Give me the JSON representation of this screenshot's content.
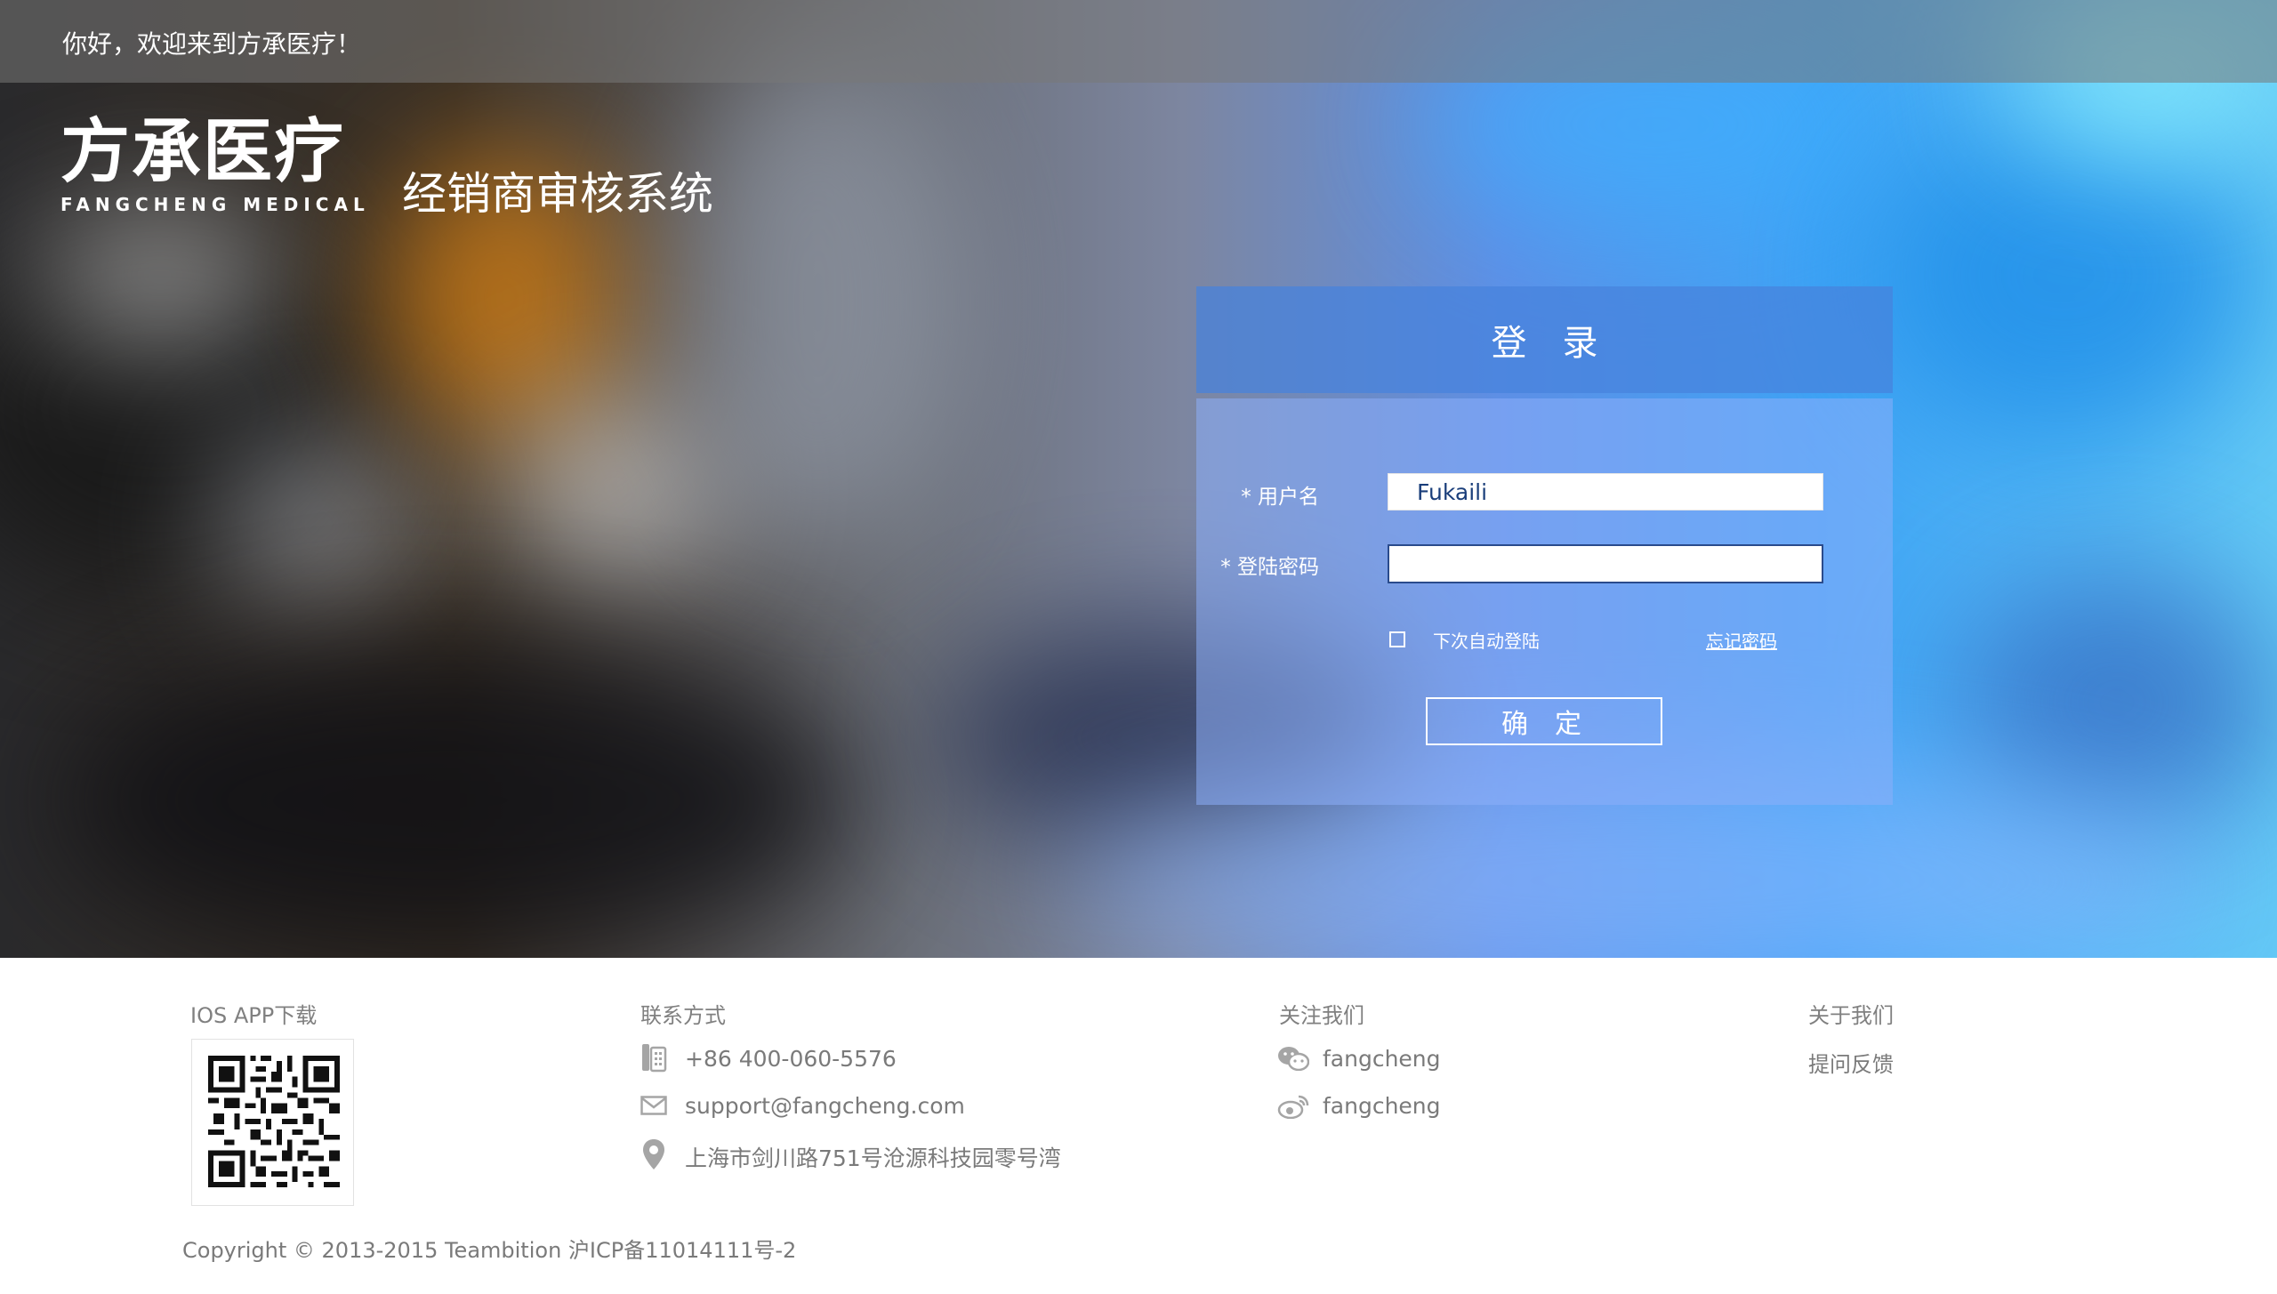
{
  "header": {
    "greeting": "你好，欢迎来到方承医疗！",
    "logo_cn": "方承医疗",
    "logo_en": "FANGCHENG MEDICAL",
    "system_title": "经销商审核系统"
  },
  "login": {
    "title": "登录",
    "username_label": "* 用户名",
    "username_value": "Fukaili",
    "password_label": "* 登陆密码",
    "password_value": "",
    "remember_label": "下次自动登陆",
    "remember_checked": false,
    "forgot_label": "忘记密码",
    "submit_label": "确定"
  },
  "footer": {
    "app": {
      "heading": "IOS APP下载"
    },
    "contact": {
      "heading": "联系方式",
      "phone": "+86 400-060-5576",
      "email": "support@fangcheng.com",
      "address": "上海市剑川路751号沧源科技园零号湾"
    },
    "follow": {
      "heading": "关注我们",
      "wechat": "fangcheng",
      "weibo": "fangcheng"
    },
    "about": {
      "heading": "关于我们",
      "feedback": "提问反馈"
    },
    "copyright": "Copyright © 2013-2015 Teambition 沪ICP备11014111号-2"
  },
  "icons": {
    "phone": "phone-icon",
    "email": "mail-icon",
    "address": "location-pin-icon",
    "wechat": "wechat-icon",
    "weibo": "weibo-icon"
  },
  "colors": {
    "login_header": "#4682DC",
    "footer_text": "#7a7a7a",
    "input_text": "#1a3e7a"
  }
}
